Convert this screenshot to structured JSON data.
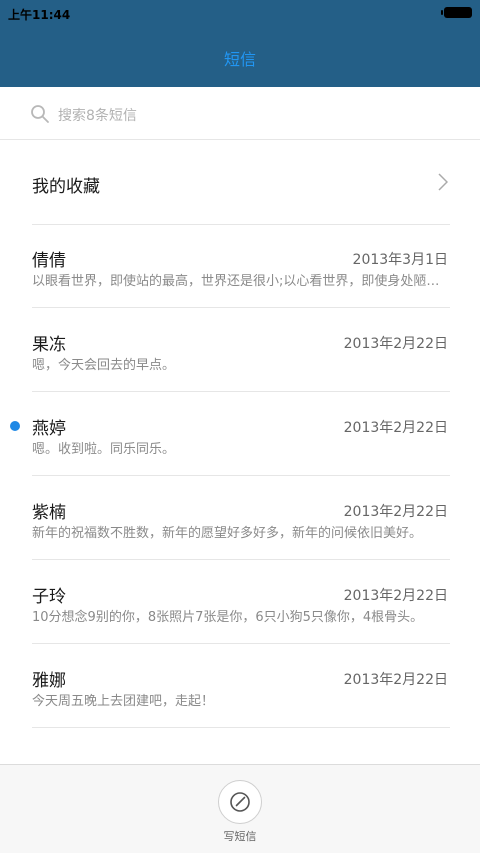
{
  "status_bar": {
    "time": "上午11:44"
  },
  "header": {
    "title": "短信"
  },
  "search": {
    "placeholder": "搜索8条短信"
  },
  "favorites": {
    "label": "我的收藏"
  },
  "messages": [
    {
      "name": "倩倩",
      "date": "2013年3月1日",
      "preview": "以眼看世界，即使站的最高，世界还是很小;以心看世界，即使身处陋室，世界依旧很大。",
      "unread": false
    },
    {
      "name": "果冻",
      "date": "2013年2月22日",
      "preview": "嗯，今天会回去的早点。",
      "unread": false
    },
    {
      "name": "燕婷",
      "date": "2013年2月22日",
      "preview": "嗯。收到啦。同乐同乐。",
      "unread": true
    },
    {
      "name": "紫楠",
      "date": "2013年2月22日",
      "preview": "新年的祝福数不胜数，新年的愿望好多好多，新年的问候依旧美好。",
      "unread": false
    },
    {
      "name": "子玲",
      "date": "2013年2月22日",
      "preview": "10分想念9别的你，8张照片7张是你，6只小狗5只像你，4根骨头。",
      "unread": false
    },
    {
      "name": "雅娜",
      "date": "2013年2月22日",
      "preview": "今天周五晚上去团建吧，走起！",
      "unread": false
    }
  ],
  "bottom_bar": {
    "compose_label": "写短信"
  },
  "colors": {
    "header_bg": "#245f87",
    "accent": "#2196f3",
    "unread_dot": "#1e88e5"
  }
}
